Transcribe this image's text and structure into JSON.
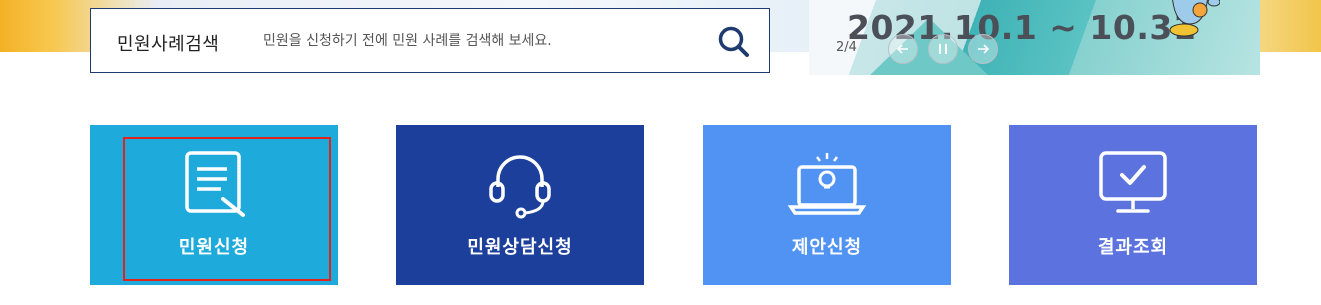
{
  "search": {
    "title": "민원사례검색",
    "placeholder": "민원을 신청하기 전에 민원 사례를 검색해 보세요.",
    "button_icon": "search-icon"
  },
  "banner": {
    "date_text": "2021.10.1 ~ 10.31",
    "slide_counter": "2/4",
    "controls": [
      "prev-arrow-icon",
      "pause-icon",
      "next-arrow-icon"
    ]
  },
  "tiles": [
    {
      "label": "민원신청",
      "icon": "document-edit-icon",
      "color": "#1eaadb"
    },
    {
      "label": "민원상담신청",
      "icon": "headset-icon",
      "color": "#1b3f9b"
    },
    {
      "label": "제안신청",
      "icon": "laptop-lightbulb-icon",
      "color": "#5193f3"
    },
    {
      "label": "결과조회",
      "icon": "monitor-check-icon",
      "color": "#5b72df"
    }
  ],
  "colors": {
    "focus_outline": "#e0241c",
    "search_border": "#1e3a6e"
  }
}
